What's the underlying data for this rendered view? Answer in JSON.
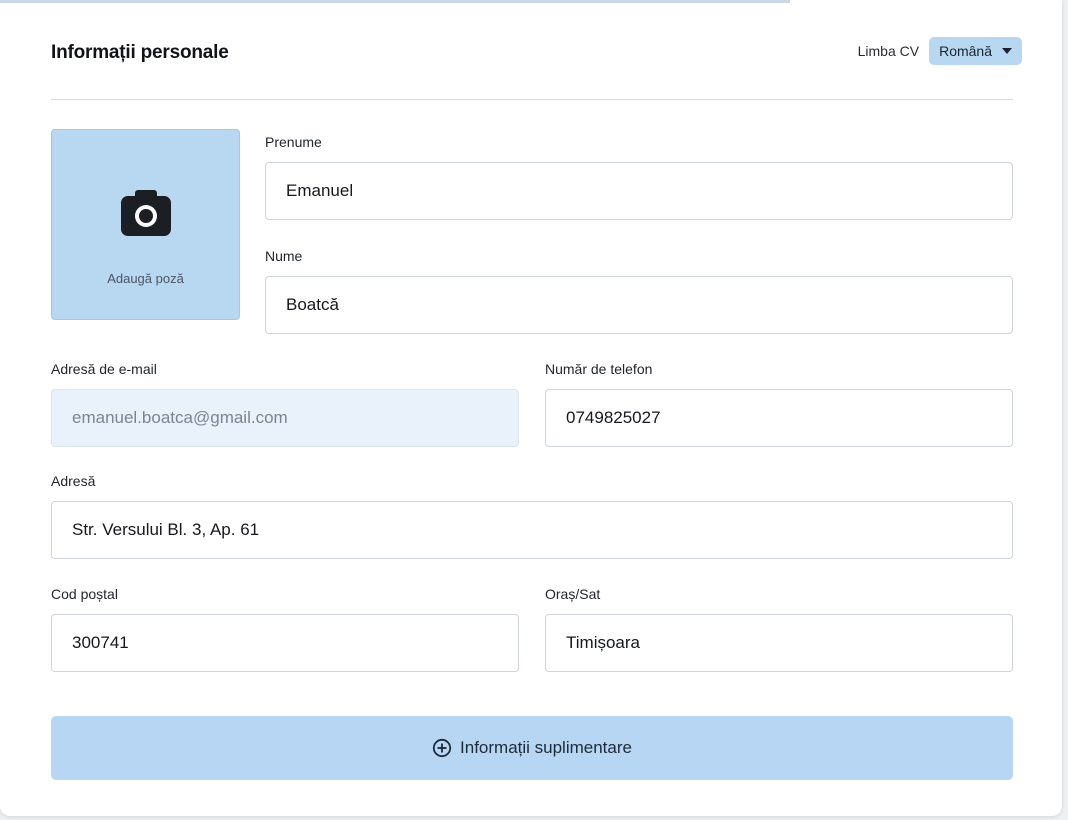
{
  "header": {
    "title": "Informații personale",
    "language_label": "Limba CV",
    "language_value": "Română"
  },
  "photo": {
    "icon": "camera-icon",
    "label": "Adaugă poză"
  },
  "fields": {
    "first_name": {
      "label": "Prenume",
      "value": "Emanuel"
    },
    "last_name": {
      "label": "Nume",
      "value": "Boatcă"
    },
    "email": {
      "label": "Adresă de e-mail",
      "value": "emanuel.boatca@gmail.com"
    },
    "phone": {
      "label": "Număr de telefon",
      "value": "0749825027"
    },
    "address": {
      "label": "Adresă",
      "value": "Str. Versului Bl. 3, Ap. 61"
    },
    "postal_code": {
      "label": "Cod poștal",
      "value": "300741"
    },
    "city": {
      "label": "Oraș/Sat",
      "value": "Timișoara"
    }
  },
  "more_button": {
    "icon": "plus-circle-icon",
    "label": "Informații suplimentare"
  },
  "colors": {
    "accent": "#b8d7f1",
    "readonly_bg": "#e9f2fb",
    "border": "#cfd4da"
  }
}
